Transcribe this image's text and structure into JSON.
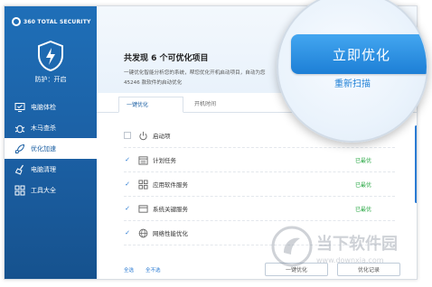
{
  "app": {
    "brand": "360 TOTAL SECURITY"
  },
  "sidebar": {
    "protection_status": "防护：开启",
    "items": [
      {
        "label": "电脑体检",
        "icon": "monitor-check-icon"
      },
      {
        "label": "木马查杀",
        "icon": "bug-icon"
      },
      {
        "label": "优化加速",
        "icon": "rocket-icon",
        "active": true
      },
      {
        "label": "电脑清理",
        "icon": "broom-icon"
      },
      {
        "label": "工具大全",
        "icon": "grid-icon"
      }
    ]
  },
  "header": {
    "title": "共发现 6 个可优化项目",
    "description_line1": "一键优化智能分析您的系统，帮您优化开机启动项目，自动为您",
    "description_line2": "45246 款软件的启动优化"
  },
  "tabs": [
    "一键优化",
    "开机时间"
  ],
  "items": [
    {
      "label": "启动项",
      "checked": false,
      "icon": "power-icon",
      "status": ""
    },
    {
      "label": "计划任务",
      "checked": true,
      "icon": "calendar-icon",
      "status": "已最优"
    },
    {
      "label": "应用软件服务",
      "checked": true,
      "icon": "apps-icon",
      "status": "已最优"
    },
    {
      "label": "系统关键服务",
      "checked": true,
      "icon": "window-icon",
      "status": "已最优"
    },
    {
      "label": "网络性能优化",
      "checked": true,
      "icon": "globe-icon",
      "status": ""
    }
  ],
  "footer": {
    "select_all": "全选",
    "select_none": "全不选",
    "btn_left": "一键优化",
    "btn_right": "优化记录"
  },
  "bubble": {
    "optimize_button": "立即优化",
    "rescan_link": "重新扫描"
  },
  "watermark": {
    "text": "当下软件园",
    "url": "www.downxia.com"
  },
  "colors": {
    "brand_blue": "#1b5fa3",
    "accent_blue": "#2a7bd3",
    "status_green": "#2aa845"
  }
}
